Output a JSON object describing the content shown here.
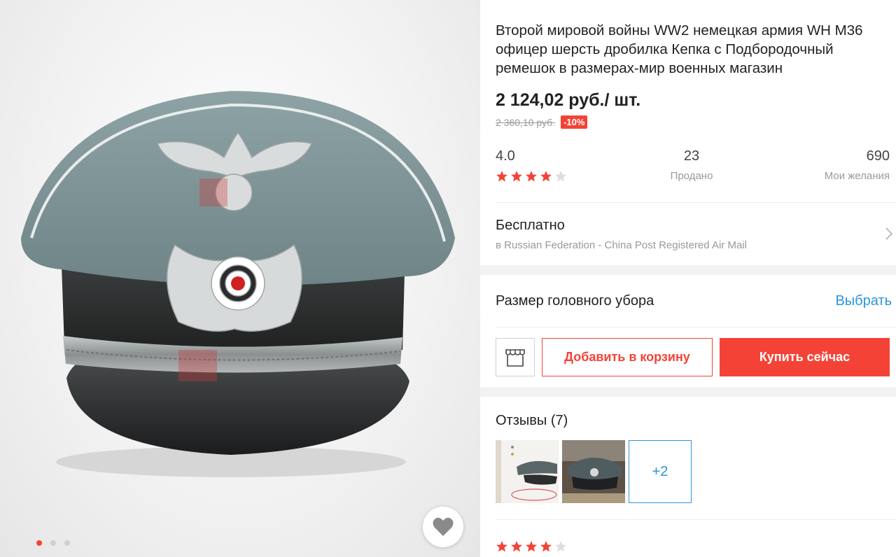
{
  "product": {
    "title": "Второй мировой войны WW2 немецкая армия WH M36 офицер шерсть дробилка Кепка с Подбородочный ремешок в размерах-мир военных магазин",
    "price": "2 124,02 руб./ шт.",
    "old_price": "2 360,10 руб.",
    "discount": "-10%"
  },
  "stats": {
    "rating": "4.0",
    "rating_stars": 4,
    "sold_count": "23",
    "sold_label": "Продано",
    "wishlist_count": "690",
    "wishlist_label": "Мои желания"
  },
  "shipping": {
    "title": "Бесплатно",
    "subtitle": "в Russian Federation - China Post Registered Air Mail"
  },
  "size": {
    "label": "Размер головного убора",
    "action": "Выбрать"
  },
  "actions": {
    "add_to_cart": "Добавить в корзину",
    "buy_now": "Купить сейчас"
  },
  "reviews": {
    "title": "Отзывы (7)",
    "more_label": "+2",
    "first_review_stars": 4
  },
  "gallery": {
    "total_images": 3,
    "active_index": 0
  },
  "colors": {
    "accent": "#f44336",
    "link": "#2a96d9",
    "star_empty": "#dddddd"
  },
  "icons": {
    "favorite": "heart-icon",
    "store": "store-awning-icon",
    "chevron": "chevron-right-icon",
    "star": "star-icon"
  }
}
